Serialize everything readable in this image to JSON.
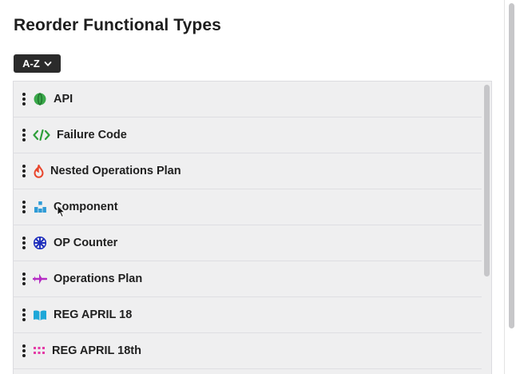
{
  "dialog": {
    "title": "Reorder Functional Types",
    "sort": {
      "selected": "A-Z"
    }
  },
  "types": [
    {
      "label": "API",
      "icon": "green-globe-icon",
      "color": "#3aa84a"
    },
    {
      "label": "Failure Code",
      "icon": "code-brackets-icon",
      "color": "#2e9f3a"
    },
    {
      "label": "Nested Operations Plan",
      "icon": "flame-icon",
      "color": "#e8452c"
    },
    {
      "label": "Component",
      "icon": "boxes-icon",
      "color": "#2f9bd6"
    },
    {
      "label": "OP Counter",
      "icon": "pinwheel-icon",
      "color": "#1f2fbd"
    },
    {
      "label": "Operations Plan",
      "icon": "airplane-icon",
      "color": "#b62cc4"
    },
    {
      "label": "REG APRIL 18",
      "icon": "open-book-icon",
      "color": "#1ea7d8"
    },
    {
      "label": "REG APRIL 18th",
      "icon": "grid-dots-icon",
      "color": "#e43aa6"
    }
  ]
}
